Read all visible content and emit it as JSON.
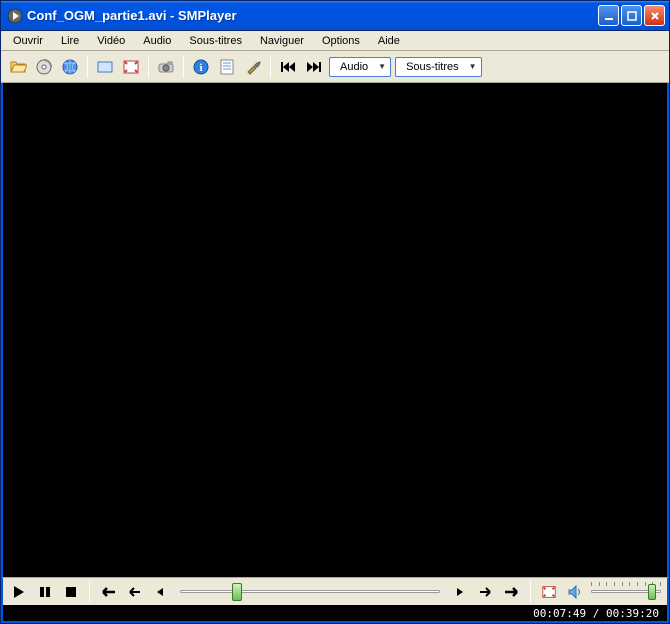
{
  "window": {
    "title": "Conf_OGM_partie1.avi - SMPlayer"
  },
  "menu": {
    "items": [
      "Ouvrir",
      "Lire",
      "Vidéo",
      "Audio",
      "Sous-titres",
      "Naviguer",
      "Options",
      "Aide"
    ]
  },
  "toolbar": {
    "audio_dropdown": "Audio",
    "subtitles_dropdown": "Sous-titres"
  },
  "playback": {
    "seek_percent": 20,
    "volume_percent": 92
  },
  "status": {
    "current_time": "00:07:49",
    "total_time": "00:39:20"
  }
}
